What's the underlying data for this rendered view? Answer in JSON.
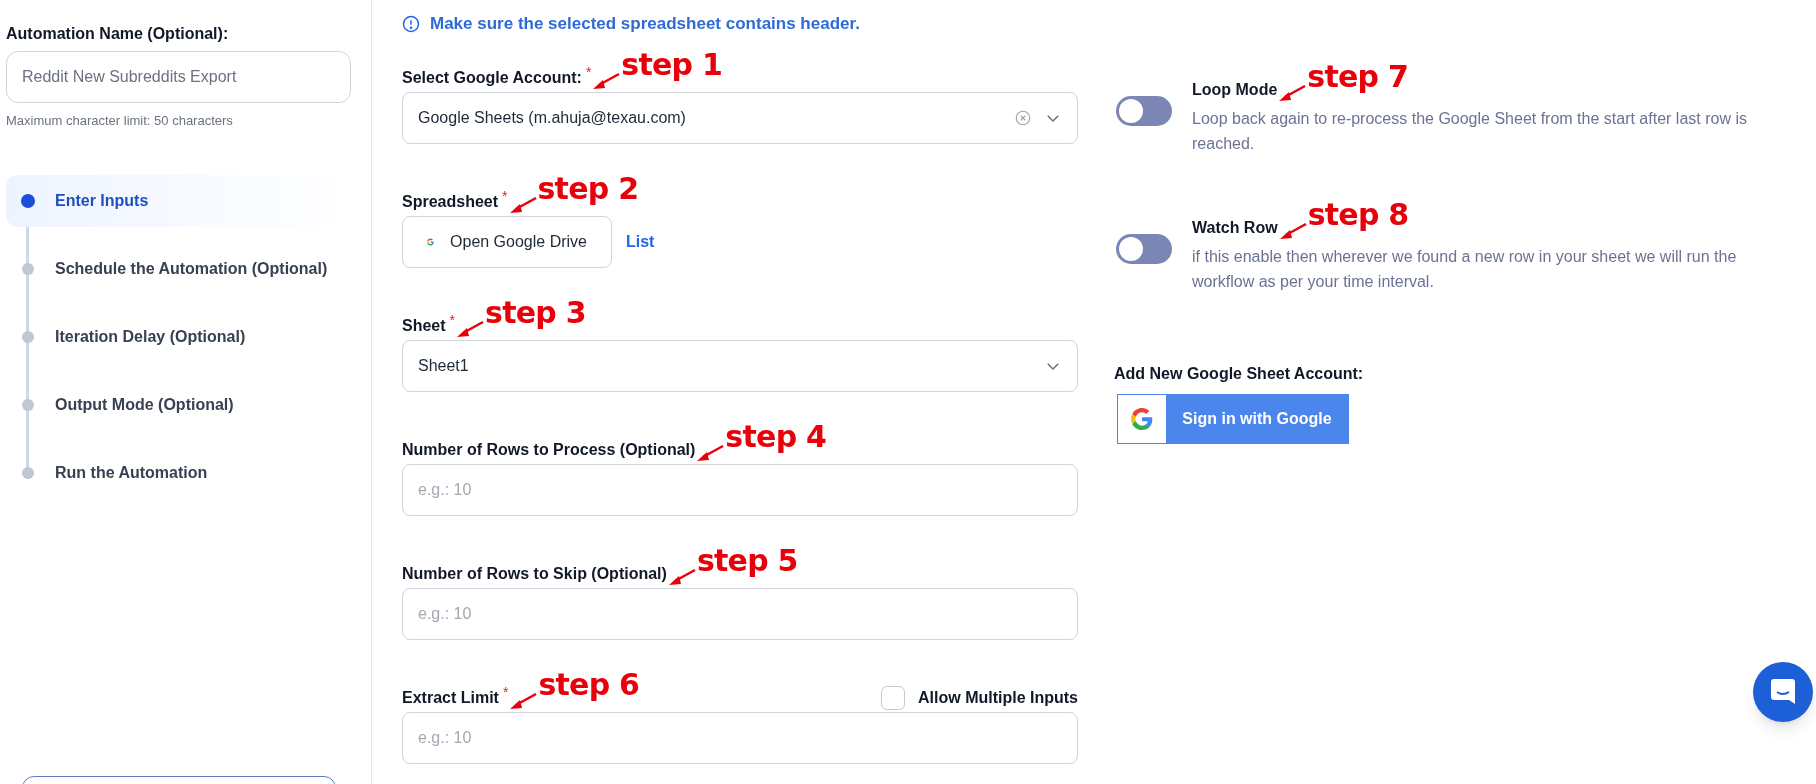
{
  "automation_name": {
    "label": "Automation Name (Optional):",
    "placeholder": "Reddit New Subreddits Export",
    "hint": "Maximum character limit: 50 characters"
  },
  "steps": [
    {
      "label": "Enter Inputs",
      "selected": true
    },
    {
      "label": "Schedule the Automation (Optional)",
      "selected": false
    },
    {
      "label": "Iteration Delay (Optional)",
      "selected": false
    },
    {
      "label": "Output Mode (Optional)",
      "selected": false
    },
    {
      "label": "Run the Automation",
      "selected": false
    }
  ],
  "notice": "Make sure the selected spreadsheet contains header.",
  "fields": [
    {
      "kind": "select",
      "label": "Select Google Account:",
      "required_mark": "*",
      "annotation": "step 1",
      "value": "Google Sheets (m.ahuja@texau.com)",
      "clearable": true
    },
    {
      "kind": "drive",
      "label": "Spreadsheet",
      "required_mark": "*",
      "annotation": "step 2",
      "button": "Open Google Drive",
      "link": "List"
    },
    {
      "kind": "select",
      "label": "Sheet",
      "required_mark": "*",
      "annotation": "step 3",
      "value": "Sheet1",
      "clearable": false
    },
    {
      "kind": "input",
      "label": "Number of Rows to Process (Optional)",
      "annotation": "step 4",
      "placeholder": "e.g.: 10"
    },
    {
      "kind": "input",
      "label": "Number of Rows to Skip (Optional)",
      "annotation": "step 5",
      "placeholder": "e.g.: 10"
    },
    {
      "kind": "input",
      "label": "Extract Limit",
      "required_mark": "*",
      "annotation": "step 6",
      "placeholder": "e.g.: 10",
      "checkbox": {
        "label": "Allow Multiple Inputs",
        "checked": false
      }
    }
  ],
  "toggles": [
    {
      "title": "Loop Mode",
      "annotation": "step 7",
      "description": "Loop back again to re-process the Google Sheet from the start after last row is reached.",
      "on": false
    },
    {
      "title": "Watch Row",
      "annotation": "step 8",
      "description": "if this enable then wherever we found a new row in your sheet we will run the workflow as per your time interval.",
      "on": false
    }
  ],
  "google_account": {
    "label": "Add New Google Sheet Account:",
    "button": "Sign in with Google"
  }
}
